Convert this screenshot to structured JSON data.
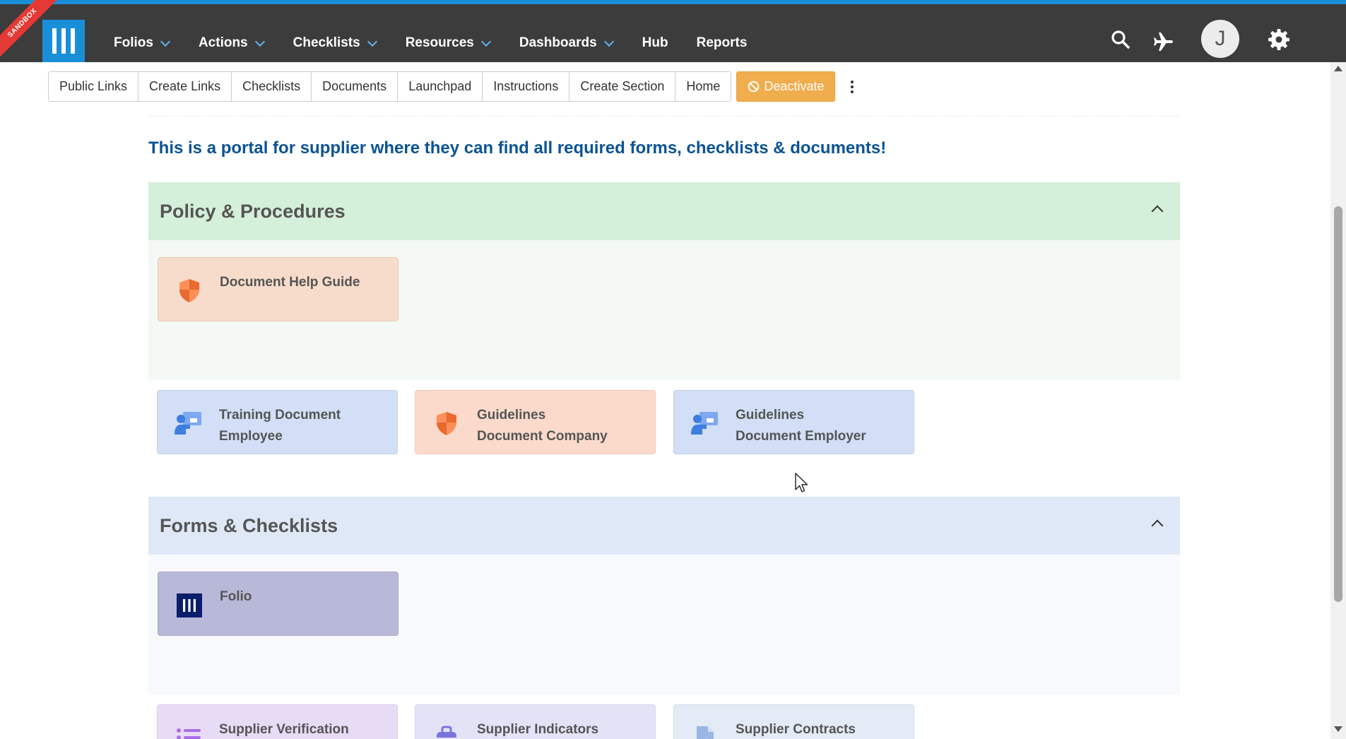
{
  "nav": {
    "sandbox_label": "SANDBOX",
    "items": [
      {
        "label": "Folios",
        "dropdown": true
      },
      {
        "label": "Actions",
        "dropdown": true
      },
      {
        "label": "Checklists",
        "dropdown": true
      },
      {
        "label": "Resources",
        "dropdown": true
      },
      {
        "label": "Dashboards",
        "dropdown": true
      },
      {
        "label": "Hub",
        "dropdown": false
      },
      {
        "label": "Reports",
        "dropdown": false
      }
    ],
    "avatar_initial": "J",
    "icons": [
      "search-icon",
      "plane-icon",
      "gear-icon"
    ]
  },
  "toolbar": {
    "buttons": [
      "Public Links",
      "Create Links",
      "Checklists",
      "Documents",
      "Launchpad",
      "Instructions",
      "Create Section",
      "Home"
    ],
    "deactivate_label": "Deactivate"
  },
  "headline": "This is a portal for supplier where they can find all required forms, checklists & documents!",
  "sections": [
    {
      "title": "Policy & Procedures",
      "header_color": "#d4efda",
      "body_color": "#f4f9f5",
      "cards_in_body": [
        {
          "lines": [
            "Document Help Guide"
          ],
          "color": "#f8dccb",
          "icon": "shield-icon"
        }
      ],
      "cards_below": [
        {
          "lines": [
            "Training Document",
            "Employee"
          ],
          "color": "#d2dff6",
          "icon": "presenter-icon"
        },
        {
          "lines": [
            "Guidelines",
            "Document Company"
          ],
          "color": "#fbdacb",
          "icon": "shield-icon"
        },
        {
          "lines": [
            "Guidelines",
            "Document Employer"
          ],
          "color": "#d2dff6",
          "icon": "presenter-icon"
        }
      ]
    },
    {
      "title": "Forms & Checklists",
      "header_color": "#dfe8f6",
      "body_color": "#f7f9fc",
      "cards_in_body": [
        {
          "lines": [
            "Folio"
          ],
          "color": "#b8b9d9",
          "icon": "folio-logo-icon"
        }
      ],
      "cards_below": [
        {
          "lines": [
            "Supplier Verification"
          ],
          "color": "#e8dbf5",
          "icon": "list-icon"
        },
        {
          "lines": [
            "Supplier Indicators"
          ],
          "color": "#e3e2f7",
          "icon": "briefcase-icon"
        },
        {
          "lines": [
            "Supplier Contracts"
          ],
          "color": "#e3ebf6",
          "icon": "contract-icon"
        }
      ]
    }
  ]
}
